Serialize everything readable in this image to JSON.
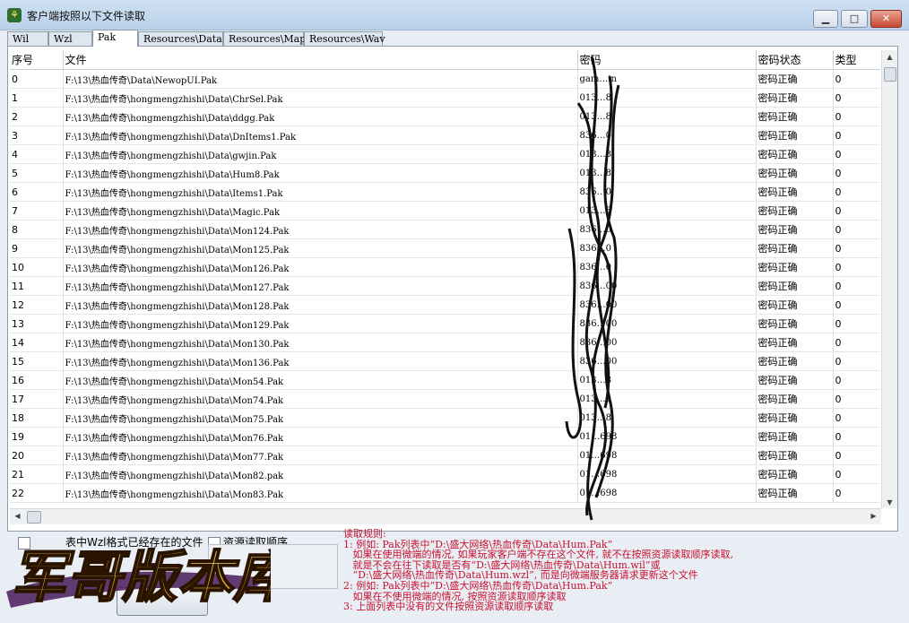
{
  "window": {
    "title": "客户端按照以下文件读取",
    "minimize_glyph": "▁",
    "maximize_glyph": "□",
    "close_glyph": "✕",
    "icon": "app-icon"
  },
  "tabs": [
    {
      "label": "Wil",
      "active": false
    },
    {
      "label": "Wzl",
      "active": false
    },
    {
      "label": "Pak",
      "active": true
    },
    {
      "label": "Resources\\Data",
      "active": false
    },
    {
      "label": "Resources\\Map",
      "active": false
    },
    {
      "label": "Resources\\Wav",
      "active": false
    }
  ],
  "grid": {
    "columns": [
      "序号",
      "文件",
      "密码",
      "密码状态",
      "类型"
    ],
    "rows": [
      {
        "index": "0",
        "file": "F:\\13\\热血传奇\\Data\\NewopUI.Pak",
        "password": "gam…in",
        "status": "密码正确",
        "type": "0"
      },
      {
        "index": "1",
        "file": "F:\\13\\热血传奇\\hongmengzhishi\\Data\\ChrSel.Pak",
        "password": "013…8",
        "status": "密码正确",
        "type": "0"
      },
      {
        "index": "2",
        "file": "F:\\13\\热血传奇\\hongmengzhishi\\Data\\ddgg.Pak",
        "password": "013…8",
        "status": "密码正确",
        "type": "0"
      },
      {
        "index": "3",
        "file": "F:\\13\\热血传奇\\hongmengzhishi\\Data\\DnItems1.Pak",
        "password": "836…0",
        "status": "密码正确",
        "type": "0"
      },
      {
        "index": "4",
        "file": "F:\\13\\热血传奇\\hongmengzhishi\\Data\\gwjin.Pak",
        "password": "013…8",
        "status": "密码正确",
        "type": "0"
      },
      {
        "index": "5",
        "file": "F:\\13\\热血传奇\\hongmengzhishi\\Data\\Hum8.Pak",
        "password": "013…8",
        "status": "密码正确",
        "type": "0"
      },
      {
        "index": "6",
        "file": "F:\\13\\热血传奇\\hongmengzhishi\\Data\\Items1.Pak",
        "password": "836…0",
        "status": "密码正确",
        "type": "0"
      },
      {
        "index": "7",
        "file": "F:\\13\\热血传奇\\hongmengzhishi\\Data\\Magic.Pak",
        "password": "013…8",
        "status": "密码正确",
        "type": "0"
      },
      {
        "index": "8",
        "file": "F:\\13\\热血传奇\\hongmengzhishi\\Data\\Mon124.Pak",
        "password": "836…0",
        "status": "密码正确",
        "type": "0"
      },
      {
        "index": "9",
        "file": "F:\\13\\热血传奇\\hongmengzhishi\\Data\\Mon125.Pak",
        "password": "836…0",
        "status": "密码正确",
        "type": "0"
      },
      {
        "index": "10",
        "file": "F:\\13\\热血传奇\\hongmengzhishi\\Data\\Mon126.Pak",
        "password": "836…0",
        "status": "密码正确",
        "type": "0"
      },
      {
        "index": "11",
        "file": "F:\\13\\热血传奇\\hongmengzhishi\\Data\\Mon127.Pak",
        "password": "836…00",
        "status": "密码正确",
        "type": "0"
      },
      {
        "index": "12",
        "file": "F:\\13\\热血传奇\\hongmengzhishi\\Data\\Mon128.Pak",
        "password": "836…00",
        "status": "密码正确",
        "type": "0"
      },
      {
        "index": "13",
        "file": "F:\\13\\热血传奇\\hongmengzhishi\\Data\\Mon129.Pak",
        "password": "836…00",
        "status": "密码正确",
        "type": "0"
      },
      {
        "index": "14",
        "file": "F:\\13\\热血传奇\\hongmengzhishi\\Data\\Mon130.Pak",
        "password": "836…00",
        "status": "密码正确",
        "type": "0"
      },
      {
        "index": "15",
        "file": "F:\\13\\热血传奇\\hongmengzhishi\\Data\\Mon136.Pak",
        "password": "836…00",
        "status": "密码正确",
        "type": "0"
      },
      {
        "index": "16",
        "file": "F:\\13\\热血传奇\\hongmengzhishi\\Data\\Mon54.Pak",
        "password": "013…8",
        "status": "密码正确",
        "type": "0"
      },
      {
        "index": "17",
        "file": "F:\\13\\热血传奇\\hongmengzhishi\\Data\\Mon74.Pak",
        "password": "013…8",
        "status": "密码正确",
        "type": "0"
      },
      {
        "index": "18",
        "file": "F:\\13\\热血传奇\\hongmengzhishi\\Data\\Mon75.Pak",
        "password": "013…8",
        "status": "密码正确",
        "type": "0"
      },
      {
        "index": "19",
        "file": "F:\\13\\热血传奇\\hongmengzhishi\\Data\\Mon76.Pak",
        "password": "01…698",
        "status": "密码正确",
        "type": "0"
      },
      {
        "index": "20",
        "file": "F:\\13\\热血传奇\\hongmengzhishi\\Data\\Mon77.Pak",
        "password": "01…698",
        "status": "密码正确",
        "type": "0"
      },
      {
        "index": "21",
        "file": "F:\\13\\热血传奇\\hongmengzhishi\\Data\\Mon82.pak",
        "password": "01…698",
        "status": "密码正确",
        "type": "0"
      },
      {
        "index": "22",
        "file": "F:\\13\\热血传奇\\hongmengzhishi\\Data\\Mon83.Pak",
        "password": "01…698",
        "status": "密码正确",
        "type": "0"
      }
    ]
  },
  "options": {
    "wzl_exists_label": "表中Wzl格式已经存在的文件",
    "resource_order_label": "资源读取顺序"
  },
  "logo": {
    "text": "军哥版本库"
  },
  "rules": [
    "读取规则:",
    "1: 例如: Pak列表中“D:\\盛大网络\\热血传奇\\Data\\Hum.Pak”",
    "   如果在使用微端的情况, 如果玩家客户端不存在这个文件, 就不在按照资源读取顺序读取,",
    "   就是不会在往下读取是否有“D:\\盛大网络\\热血传奇\\Data\\Hum.wil”或",
    "   “D:\\盛大网络\\热血传奇\\Data\\Hum.wzl”, 而是向微端服务器请求更新这个文件",
    "2: 例如: Pak列表中“D:\\盛大网络\\热血传奇\\Data\\Hum.Pak”",
    "   如果在不使用微端的情况, 按照资源读取顺序读取",
    "3: 上面列表中没有的文件按照资源读取顺序读取"
  ]
}
